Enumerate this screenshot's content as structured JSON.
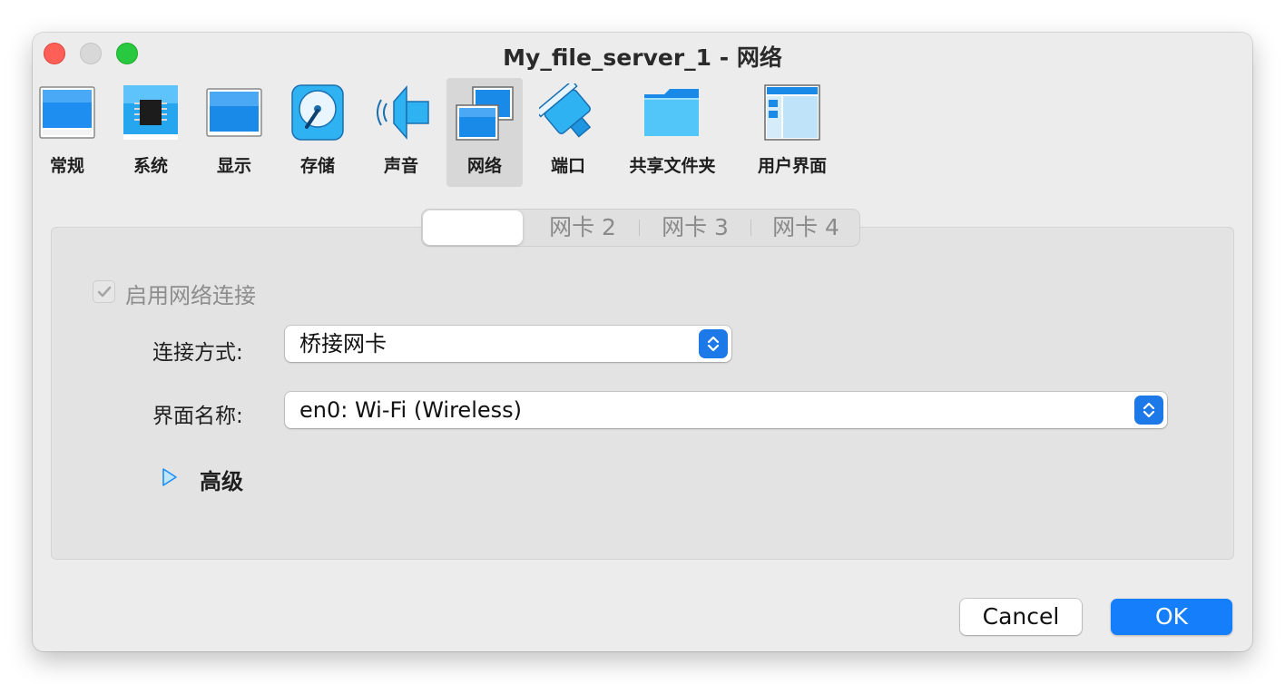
{
  "window": {
    "title": "My_file_server_1 - 网络"
  },
  "toolbar": {
    "items": [
      {
        "label": "常规",
        "icon": "general-icon"
      },
      {
        "label": "系统",
        "icon": "system-chip-icon"
      },
      {
        "label": "显示",
        "icon": "display-monitor-icon"
      },
      {
        "label": "存储",
        "icon": "storage-disk-icon"
      },
      {
        "label": "声音",
        "icon": "audio-speaker-icon"
      },
      {
        "label": "网络",
        "icon": "network-icon",
        "selected": true
      },
      {
        "label": "端口",
        "icon": "serial-port-icon"
      },
      {
        "label": "共享文件夹",
        "icon": "shared-folder-icon"
      },
      {
        "label": "用户界面",
        "icon": "user-interface-icon"
      }
    ]
  },
  "tabs": [
    {
      "label": "",
      "active": true
    },
    {
      "label": "网卡 2"
    },
    {
      "label": "网卡 3"
    },
    {
      "label": "网卡 4"
    }
  ],
  "form": {
    "enable_label": "启用网络连接",
    "enable_checked": true,
    "attached_label": "连接方式:",
    "attached_value": "桥接网卡",
    "name_label": "界面名称:",
    "name_value": "en0: Wi-Fi (Wireless)",
    "advanced_label": "高级"
  },
  "buttons": {
    "cancel": "Cancel",
    "ok": "OK"
  },
  "colors": {
    "accent": "#157efb",
    "close": "#fe5f57",
    "zoom": "#28c840"
  }
}
